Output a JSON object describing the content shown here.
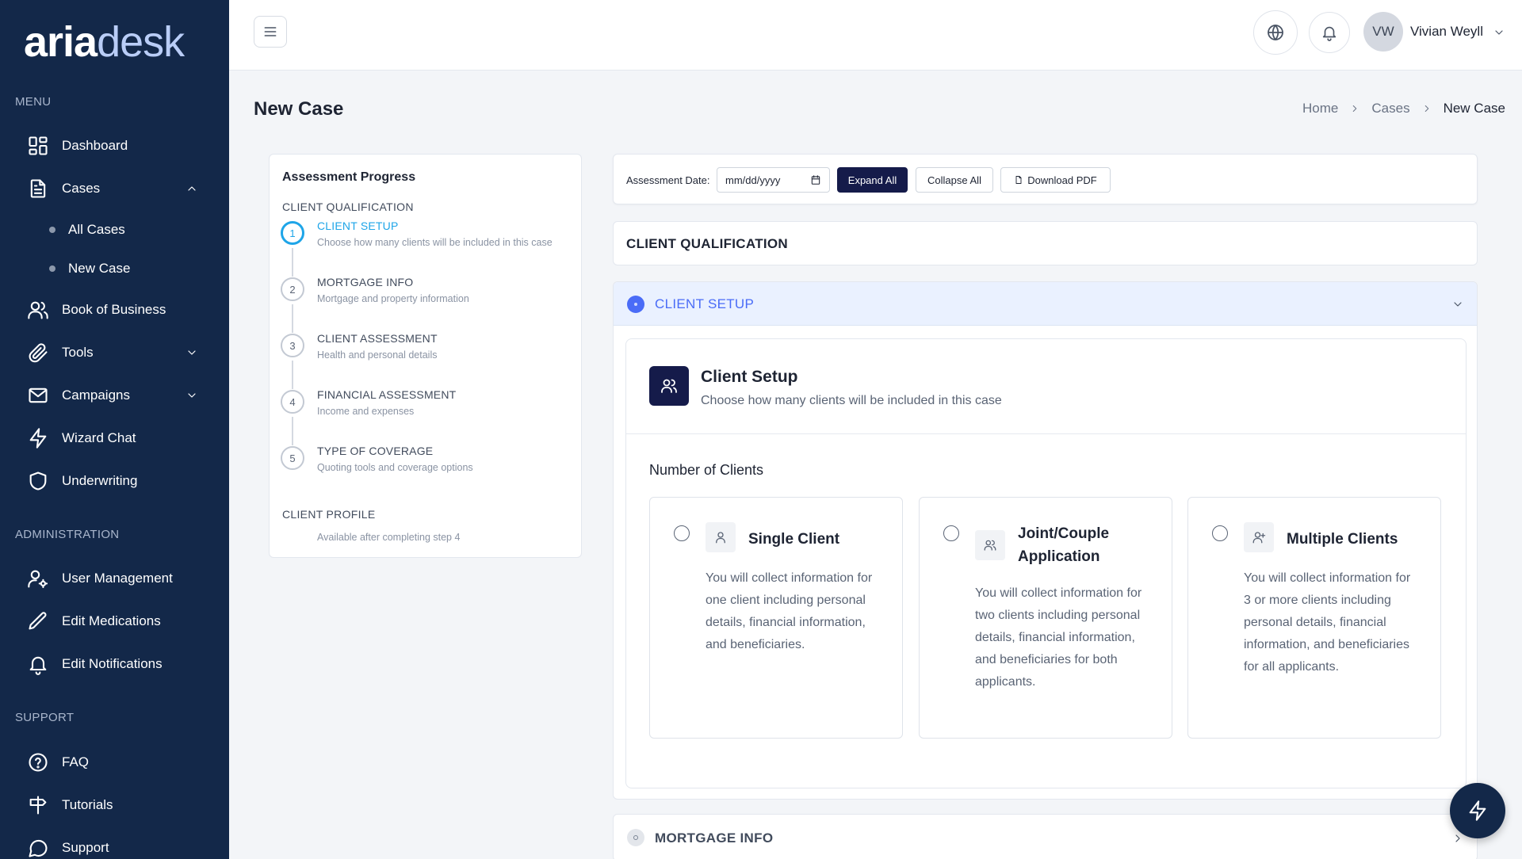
{
  "app": {
    "logo_primary": "aria",
    "logo_secondary": "desk"
  },
  "sidebar": {
    "menu_label": "MENU",
    "admin_label": "ADMINISTRATION",
    "support_label": "SUPPORT",
    "items": {
      "dashboard": "Dashboard",
      "cases": "Cases",
      "all_cases": "All Cases",
      "new_case": "New Case",
      "book_of_business": "Book of Business",
      "tools": "Tools",
      "campaigns": "Campaigns",
      "wizard_chat": "Wizard Chat",
      "underwriting": "Underwriting",
      "user_management": "User Management",
      "edit_medications": "Edit Medications",
      "edit_notifications": "Edit Notifications",
      "faq": "FAQ",
      "tutorials": "Tutorials",
      "support": "Support"
    }
  },
  "header": {
    "user_initials": "VW",
    "user_name": "Vivian Weyll"
  },
  "page": {
    "title": "New Case",
    "breadcrumb": [
      "Home",
      "Cases",
      "New Case"
    ]
  },
  "progress": {
    "title": "Assessment Progress",
    "section_qualification": "CLIENT QUALIFICATION",
    "steps": [
      {
        "num": "1",
        "title": "CLIENT SETUP",
        "desc": "Choose how many clients will be included in this case"
      },
      {
        "num": "2",
        "title": "MORTGAGE INFO",
        "desc": "Mortgage and property information"
      },
      {
        "num": "3",
        "title": "CLIENT ASSESSMENT",
        "desc": "Health and personal details"
      },
      {
        "num": "4",
        "title": "FINANCIAL ASSESSMENT",
        "desc": "Income and expenses"
      },
      {
        "num": "5",
        "title": "TYPE OF COVERAGE",
        "desc": "Quoting tools and coverage options"
      }
    ],
    "section_profile": "CLIENT PROFILE",
    "profile_desc": "Available after completing step 4"
  },
  "toolbar": {
    "date_label": "Assessment Date:",
    "date_placeholder": "mm/dd/yyyy",
    "expand_all": "Expand All",
    "collapse_all": "Collapse All",
    "download_pdf": "Download PDF"
  },
  "section": {
    "title": "CLIENT QUALIFICATION"
  },
  "accordion": {
    "title": "CLIENT SETUP",
    "card_title": "Client Setup",
    "card_subtitle": "Choose how many clients will be included in this case",
    "number_label": "Number of Clients",
    "options": [
      {
        "title": "Single Client",
        "desc": "You will collect information for one client including personal details, financial information, and beneficiaries."
      },
      {
        "title": "Joint/Couple Application",
        "desc": "You will collect information for two clients including personal details, financial information, and beneficiaries for both applicants."
      },
      {
        "title": "Multiple Clients",
        "desc": "You will collect information for 3 or more clients including personal details, financial information, and beneficiaries for all applicants."
      }
    ]
  },
  "mortgage": {
    "title": "MORTGAGE INFO"
  },
  "colors": {
    "sidebar": "#132849",
    "accent": "#4a6cf7",
    "active_step": "#1ea5e8",
    "dark_button": "#151b4a"
  }
}
